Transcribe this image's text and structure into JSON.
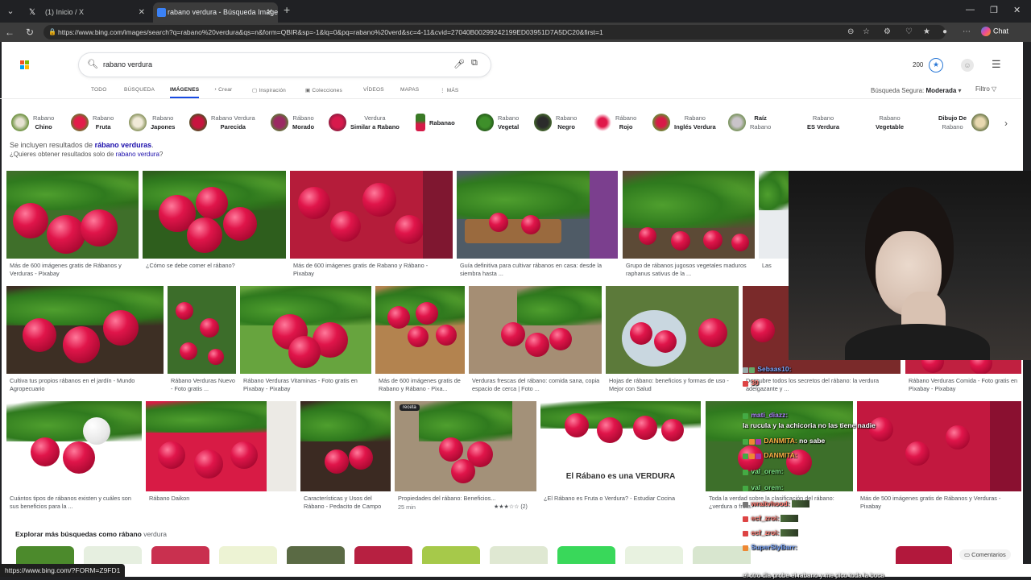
{
  "browser": {
    "tabs": [
      {
        "label": "(1) Inicio / X",
        "icon": "x-logo-icon"
      },
      {
        "label": "rabano verdura - Búsqueda Imáge",
        "icon": "bing-icon"
      }
    ],
    "new_tab": "+",
    "url": "https://www.bing.com/images/search?q=rabano%20verdura&qs=n&form=QBIR&sp=-1&lq=0&pq=rabano%20verd&sc=4-11&cvid=27040B00299242199ED03951D7A5DC20&first=1",
    "chat_label": "Chat",
    "status_url": "https://www.bing.com/?FORM=Z9FD1"
  },
  "header": {
    "query": "rabano verdura",
    "points": "200"
  },
  "nav": {
    "tabs": [
      "TODO",
      "BÚSQUEDA",
      "IMÁGENES",
      "Crear",
      "Inspiración",
      "Colecciones",
      "VÍDEOS",
      "MAPAS",
      "MÁS"
    ],
    "active": "IMÁGENES",
    "safe_label": "Búsqueda Segura:",
    "safe_value": "Moderada",
    "filter": "Filtro"
  },
  "chips": [
    {
      "l1": "Rabano",
      "l2": "Chino"
    },
    {
      "l1": "Rabano",
      "l2": "Fruta"
    },
    {
      "l1": "Rabano",
      "l2": "Japones"
    },
    {
      "l1": "Rabano Verdura",
      "l2": "Parecida"
    },
    {
      "l1": "Rábano",
      "l2": "Morado"
    },
    {
      "l1": "Verdura",
      "l2": "Similar a Rabano"
    },
    {
      "l1": "",
      "l2": "Rabanao"
    },
    {
      "l1": "Rabano",
      "l2": "Vegetal"
    },
    {
      "l1": "Rabano",
      "l2": "Negro"
    },
    {
      "l1": "Rábano",
      "l2": "Rojo"
    },
    {
      "l1": "Rabano",
      "l2": "Inglés Verdura"
    },
    {
      "l1": "Raíz",
      "l2": "Rabano"
    },
    {
      "l1": "Rabano",
      "l2": "ES Verdura"
    },
    {
      "l1": "Rabano",
      "l2": "Vegetable"
    },
    {
      "l1": "Dibujo De",
      "l2": "Rabano"
    }
  ],
  "notice": {
    "prefix": "Se incluyen resultados de",
    "link": "rábano verduras",
    "q_prefix": "¿Quieres obtener resultados solo de",
    "q_link": "rabano verdura",
    "q_suffix": "?"
  },
  "results": [
    {
      "caption": "Más de 600 imágenes gratis de Rábanos y Verduras - Pixabay"
    },
    {
      "caption": "¿Cómo se debe comer el rábano?"
    },
    {
      "caption": "Más de 600 imágenes gratis de Rabano y Rábano - Pixabay"
    },
    {
      "caption": "Guía definitiva para cultivar rábanos en casa: desde la siembra hasta ..."
    },
    {
      "caption": "Grupo de rábanos jugosos vegetales maduros raphanus sativus de la ..."
    },
    {
      "caption": "Las verdu..."
    },
    {
      "caption": "Cultiva tus propios rábanos en el jardín - Mundo Agropecuario"
    },
    {
      "caption": "Rábano Verduras Nuevo - Foto gratis ..."
    },
    {
      "caption": "Rábano Verduras Vitaminas - Foto gratis en Pixabay - Pixabay"
    },
    {
      "caption": "Más de 600 imágenes gratis de Rabano y Rábano - Pixa..."
    },
    {
      "caption": "Verduras frescas del rábano: comida sana, copia espacio de cerca | Foto ..."
    },
    {
      "caption": "Hojas de rábano: beneficios y formas de uso - Mejor con Salud"
    },
    {
      "caption": "Descubre todos los secretos del rábano: la verdura adelgazante y ..."
    },
    {
      "caption": "Rábano Verduras Comida - Foto gratis en Pixabay - Pixabay"
    },
    {
      "caption": "Cuántos tipos de rábanos existen y cuáles son sus beneficios para la ..."
    },
    {
      "caption": "Rábano Daikon"
    },
    {
      "caption": "Características y Usos del Rábano - Pedacito de Campo"
    },
    {
      "caption": "Propiedades del rábano: Beneficios...",
      "meta": "25 min",
      "rating": "★★★☆☆ (2)",
      "badge": "receta"
    },
    {
      "caption": "¿El Rábano es Fruta o Verdura? - Estudiar Cocina",
      "overlay": "El Rábano es una VERDURA"
    },
    {
      "caption": "Toda la verdad sobre la clasificación del rábano: ¿verdura o fruta?"
    },
    {
      "caption": "Más de 500 imágenes gratis de Rábanos y Verduras - Pixabay"
    }
  ],
  "explore": {
    "prefix": "Explorar más búsquedas como rábano",
    "suffix": "verdura"
  },
  "comments_label": "Comentarios",
  "overlay_chat": [
    {
      "user": "Sebaas10:",
      "text": "",
      "color": "#7aa7ff"
    },
    {
      "user": "mati_diazz:",
      "text": "",
      "color": "#b084ff"
    },
    {
      "user": "",
      "text": "la rucula y la achicoria no las tiene nadie",
      "color": "#ffffff"
    },
    {
      "user": "DANMITA:",
      "text": "no sabe",
      "color": "#ffb347"
    },
    {
      "user": "DANMITA:",
      "text": "",
      "color": "#ffb347"
    },
    {
      "user": "val_orem:",
      "text": "",
      "color": "#7ee787"
    },
    {
      "user": "val_orem:",
      "text": "",
      "color": "#7ee787"
    },
    {
      "user": "wraitvhood:",
      "text": "",
      "color": "#ff7b72"
    },
    {
      "user": "ecf_zroi:",
      "text": "",
      "color": "#ff7b72"
    },
    {
      "user": "ecf_zroi:",
      "text": "",
      "color": "#ff7b72"
    },
    {
      "user": "SuperSlyBarr:",
      "text": "",
      "color": "#7aa7ff"
    },
    {
      "user": "",
      "text": "el otro dia probe el rabano y me pico toda la boca",
      "color": "#ffffff"
    }
  ],
  "colors": {
    "accent": "#174ae4",
    "link": "#1a0dab",
    "chrome": "#202124"
  }
}
